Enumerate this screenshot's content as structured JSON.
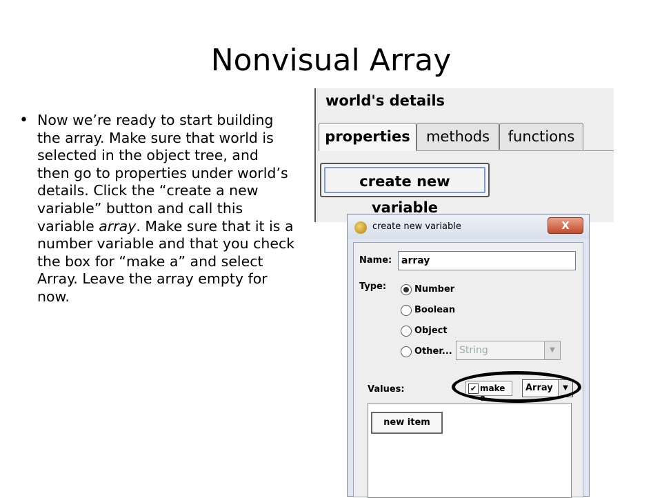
{
  "slide": {
    "title": "Nonvisual Array",
    "bullet": {
      "part1": "Now we’re ready to start building the array. Make sure that world is selected in the object tree, and then go to properties under world’s details. Click the “create a new variable” button and call this variable ",
      "italic": "array",
      "part2": ". Make sure that it is a number variable and that you check the box for “make a” and select Array. Leave the array empty for now."
    }
  },
  "details_panel": {
    "title": "world's details",
    "tabs": [
      {
        "label": "properties",
        "active": true
      },
      {
        "label": "methods",
        "active": false
      },
      {
        "label": "functions",
        "active": false
      }
    ],
    "create_button": "create new variable"
  },
  "dialog": {
    "title": "create new variable",
    "close_glyph": "X",
    "name_label": "Name:",
    "name_value": "array",
    "type_label": "Type:",
    "types": [
      {
        "label": "Number",
        "selected": true
      },
      {
        "label": "Boolean",
        "selected": false
      },
      {
        "label": "Object",
        "selected": false
      },
      {
        "label": "Other...",
        "selected": false
      }
    ],
    "other_value": "String",
    "values_label": "Values:",
    "make_a_checked_glyph": "✔",
    "make_a_label": "make a",
    "collection_value": "Array",
    "new_item_button": "new item"
  }
}
